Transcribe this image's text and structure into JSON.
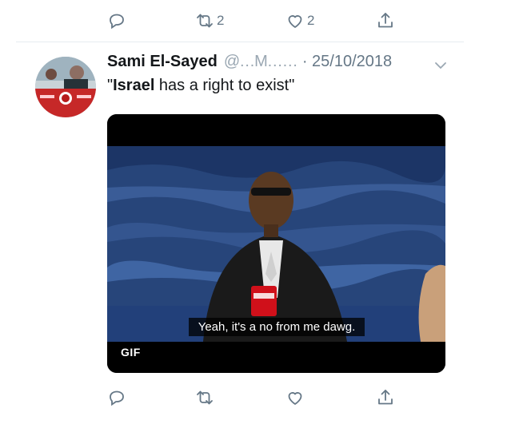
{
  "prev_tweet": {
    "actions": {
      "reply_count": "",
      "retweet_count": "2",
      "like_count": "2"
    }
  },
  "tweet": {
    "display_name": "Sami El-Sayed",
    "handle": "@…M……",
    "date": "· 25/10/2018",
    "text_bold": "Israel",
    "text_rest": " has a right to exist\"",
    "text_open_quote": "\"",
    "media": {
      "subtitle": "Yeah, it's a no from me dawg.",
      "badge": "GIF"
    },
    "actions": {
      "reply_count": "",
      "retweet_count": "",
      "like_count": ""
    }
  },
  "icons": [
    "reply-icon",
    "retweet-icon",
    "like-icon",
    "share-icon",
    "chevron-down-icon"
  ],
  "colors": {
    "icon_gray": "#657786",
    "divider": "#e6ecf0",
    "text": "#14171a"
  }
}
